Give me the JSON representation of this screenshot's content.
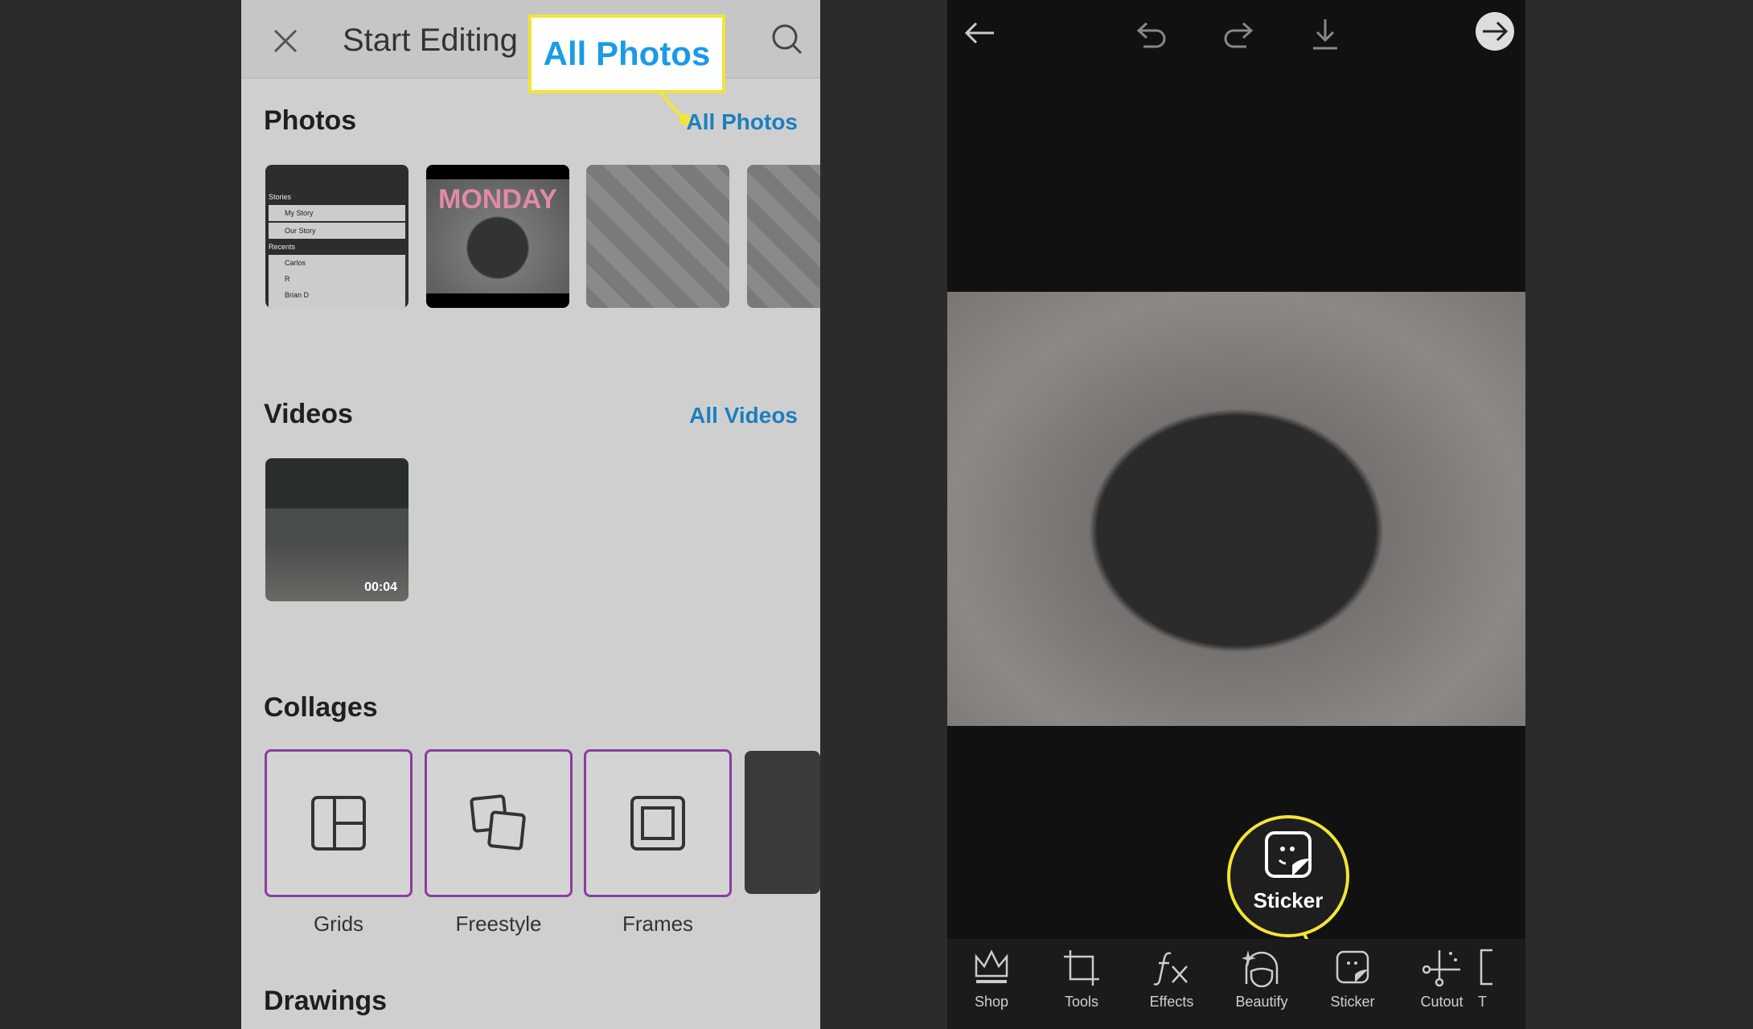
{
  "left": {
    "header": {
      "title": "Start Editing",
      "close_icon": "close-icon",
      "search_icon": "search-icon"
    },
    "callout": {
      "label": "All Photos",
      "color": "#f3e437"
    },
    "photos": {
      "title": "Photos",
      "link": "All Photos",
      "thumbs": [
        {
          "rows": [
            "Stories",
            "My Story",
            "Our Story",
            "Recents",
            "Carlos",
            "R",
            "Brian D"
          ]
        },
        {
          "text": "MONDAY"
        }
      ]
    },
    "videos": {
      "title": "Videos",
      "link": "All Videos",
      "items": [
        {
          "duration": "00:04"
        }
      ]
    },
    "collages": {
      "title": "Collages",
      "items": [
        {
          "label": "Grids",
          "icon": "grid-icon"
        },
        {
          "label": "Freestyle",
          "icon": "freestyle-icon"
        },
        {
          "label": "Frames",
          "icon": "frame-icon"
        }
      ]
    },
    "drawings": {
      "title": "Drawings"
    }
  },
  "right": {
    "topbar": [
      "back-arrow-icon",
      "undo-icon",
      "redo-icon",
      "download-icon",
      "next-arrow-icon"
    ],
    "callout": {
      "label": "Sticker"
    },
    "toolbar": [
      {
        "label": "Shop"
      },
      {
        "label": "Tools"
      },
      {
        "label": "Effects"
      },
      {
        "label": "Beautify"
      },
      {
        "label": "Sticker"
      },
      {
        "label": "Cutout"
      },
      {
        "label": "T"
      }
    ]
  }
}
